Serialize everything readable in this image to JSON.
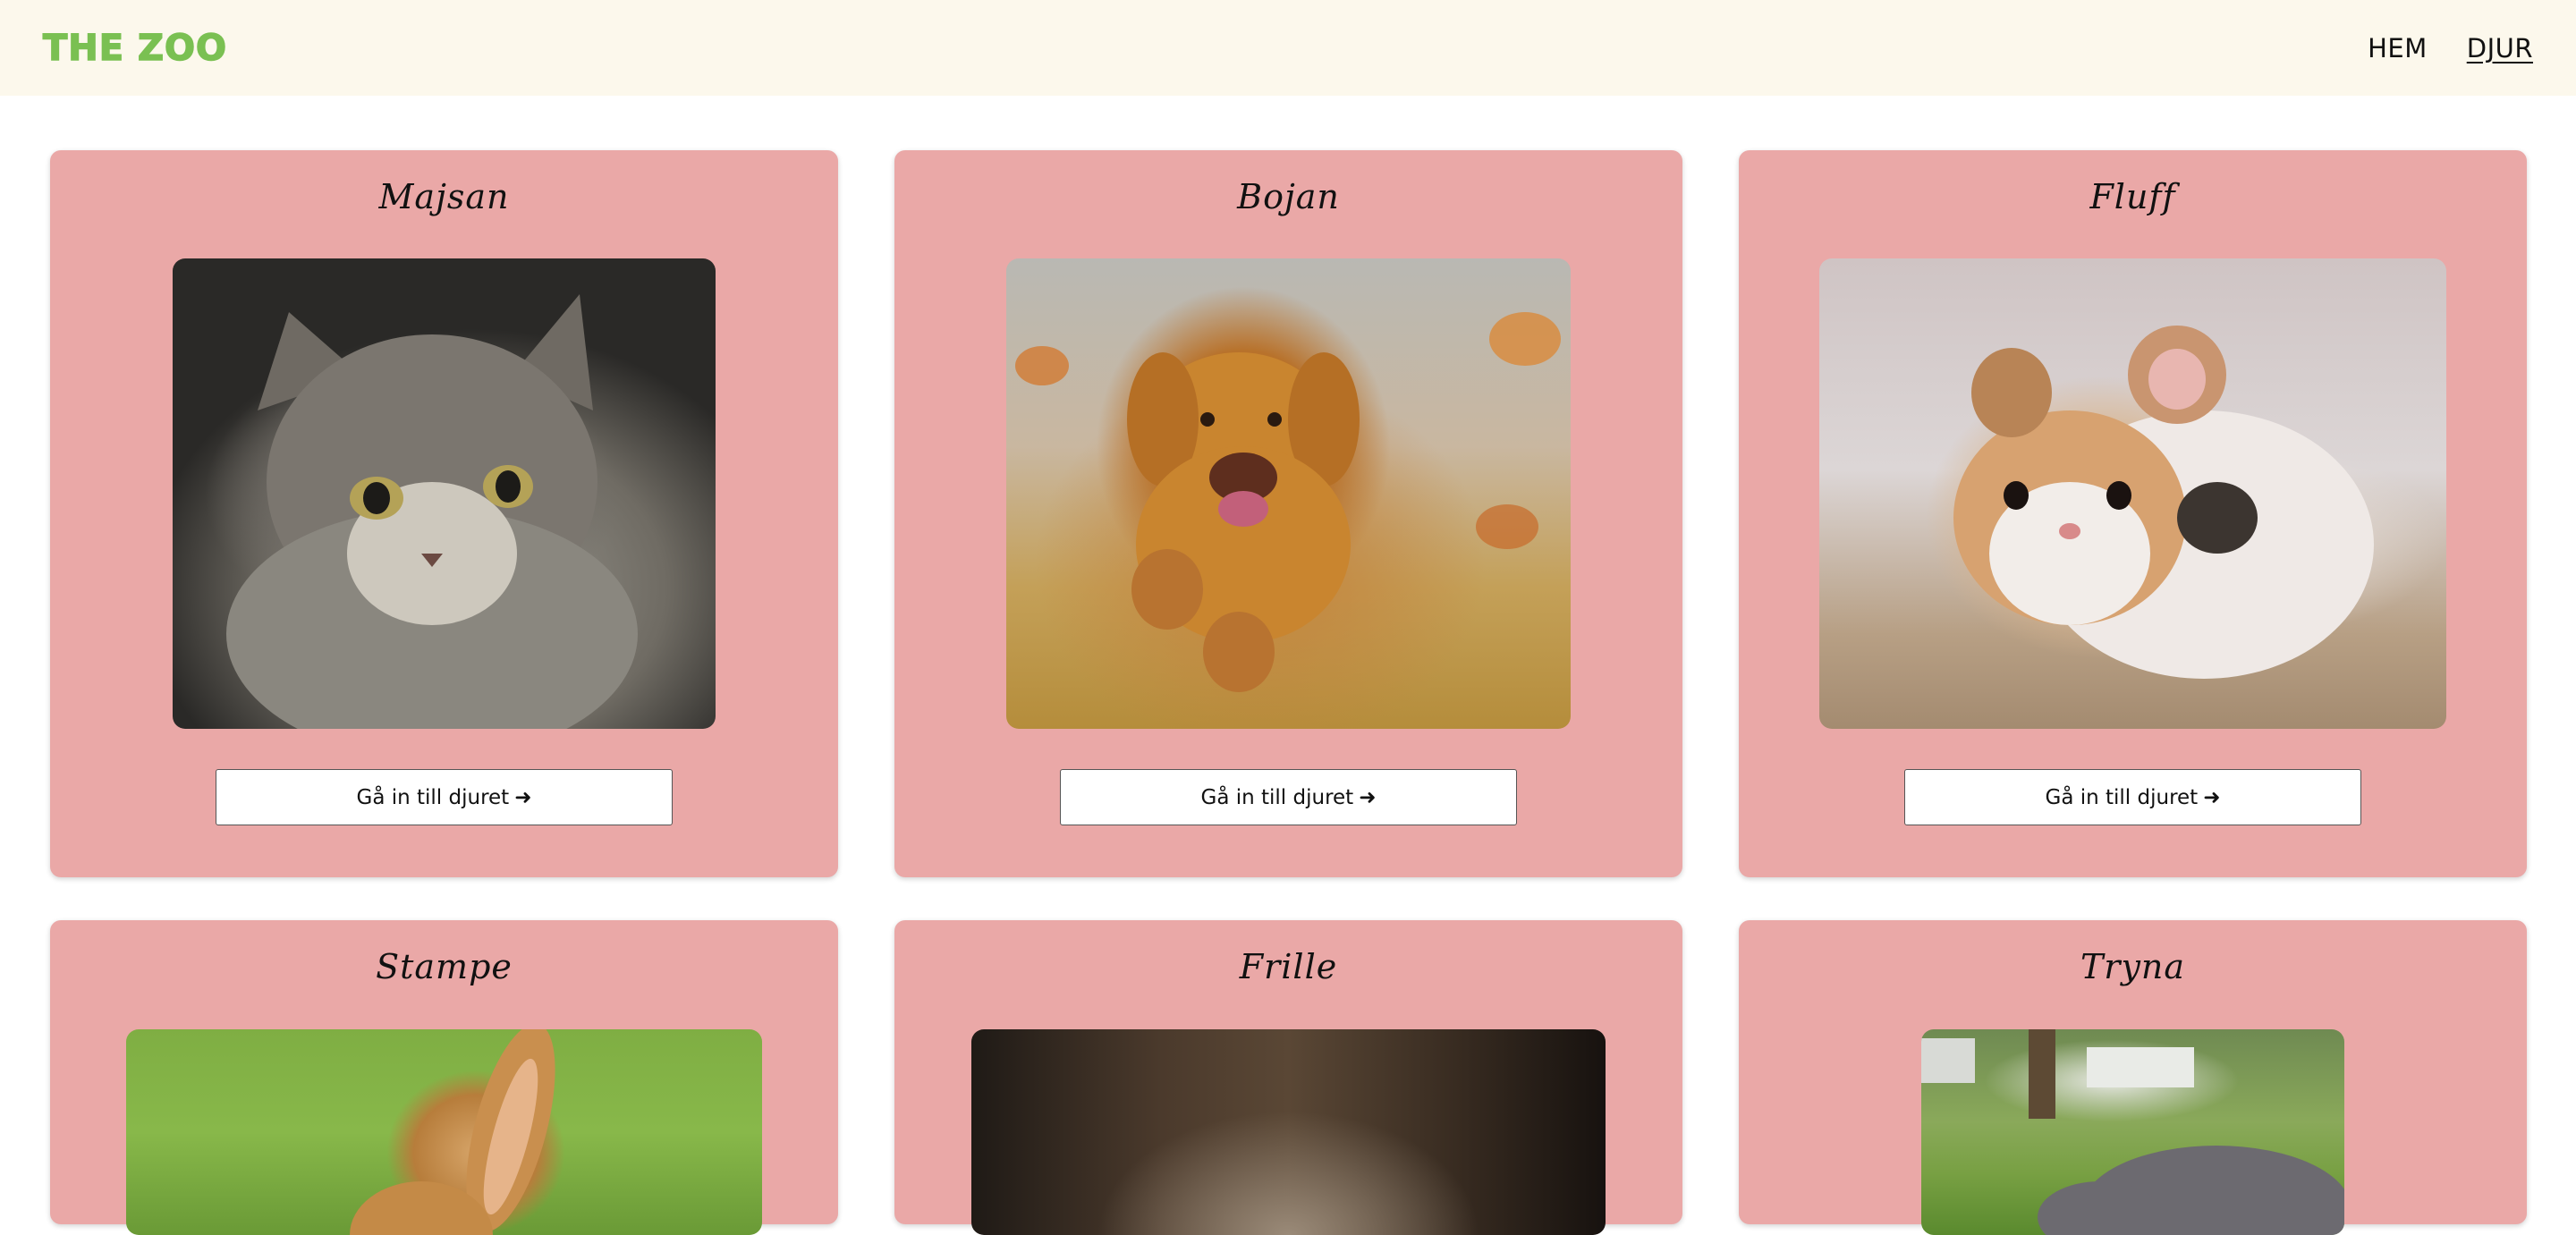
{
  "header": {
    "logo": "THE ZOO",
    "nav": [
      {
        "label": "HEM",
        "active": false
      },
      {
        "label": "DJUR",
        "active": true
      }
    ]
  },
  "colors": {
    "header_bg": "#fcf8ec",
    "logo": "#7ac052",
    "card_bg": "#eaa8a7"
  },
  "animals": [
    {
      "name": "Majsan",
      "image": "cat-photo",
      "button": "Gå in till djuret",
      "button_icon": "➜"
    },
    {
      "name": "Bojan",
      "image": "dog-photo",
      "button": "Gå in till djuret",
      "button_icon": "➜"
    },
    {
      "name": "Fluff",
      "image": "hamster-photo",
      "button": "Gå in till djuret",
      "button_icon": "➜"
    },
    {
      "name": "Stampe",
      "image": "rabbit-photo"
    },
    {
      "name": "Frille",
      "image": "frille-photo"
    },
    {
      "name": "Tryna",
      "image": "pig-photo"
    }
  ]
}
